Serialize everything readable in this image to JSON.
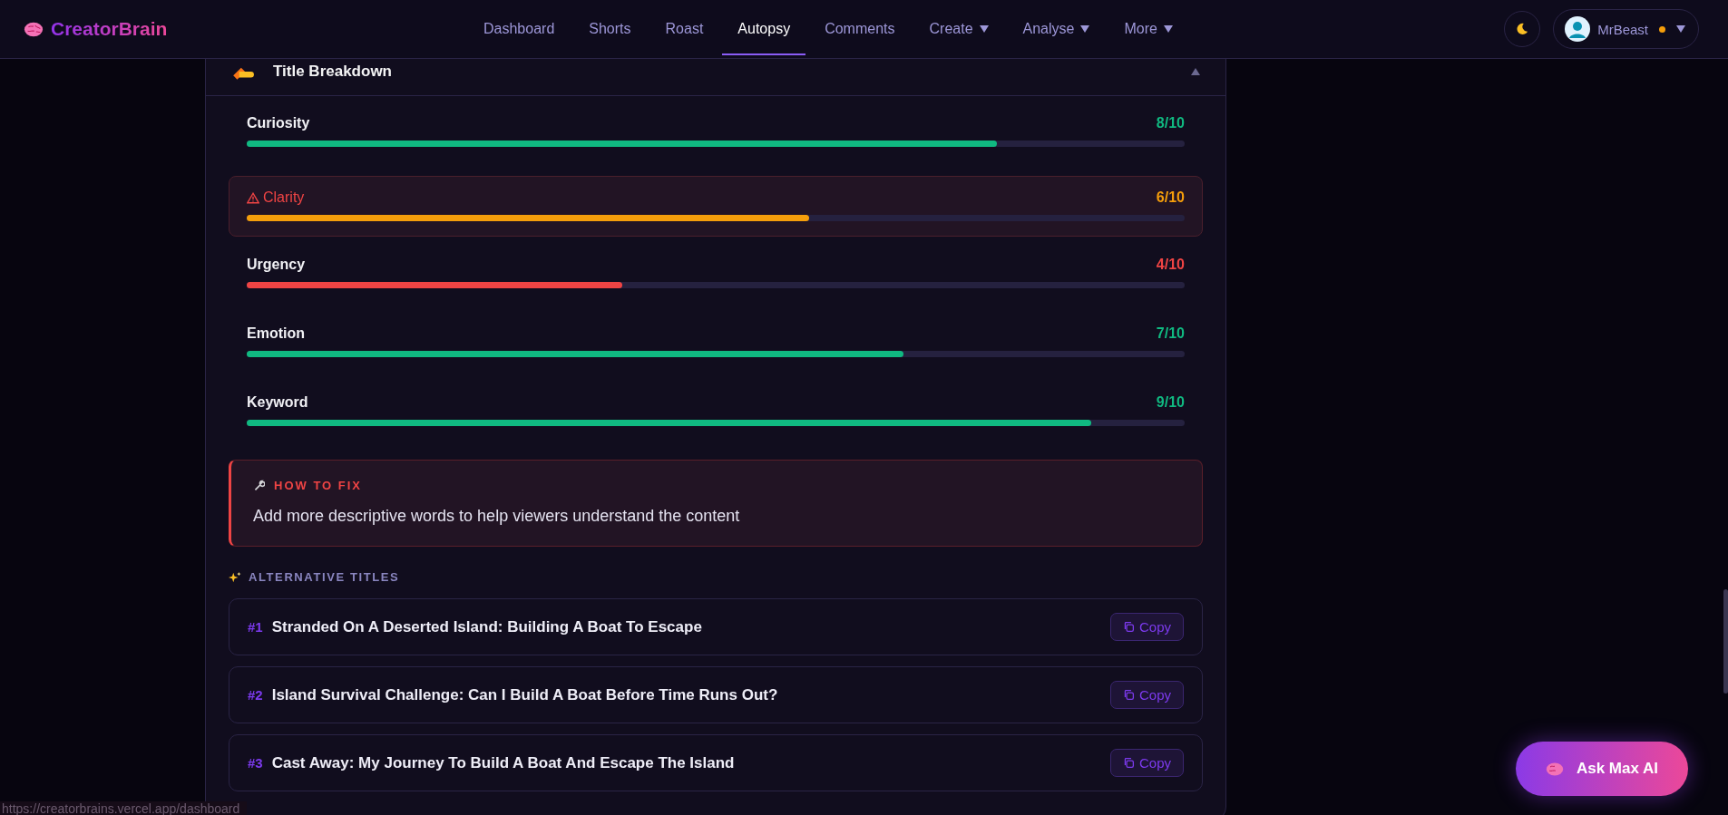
{
  "brand": {
    "name": "CreatorBrain"
  },
  "nav": [
    {
      "label": "Dashboard",
      "kind": "link",
      "selected": false
    },
    {
      "label": "Shorts",
      "kind": "link",
      "selected": false
    },
    {
      "label": "Roast",
      "kind": "link",
      "selected": false
    },
    {
      "label": "Autopsy",
      "kind": "link",
      "selected": true
    },
    {
      "label": "Comments",
      "kind": "link",
      "selected": false
    },
    {
      "label": "Create",
      "kind": "dropdown",
      "selected": false
    },
    {
      "label": "Analyse",
      "kind": "dropdown",
      "selected": false
    },
    {
      "label": "More",
      "kind": "dropdown",
      "selected": false
    }
  ],
  "user": {
    "name": "MrBeast",
    "online": true
  },
  "section": {
    "title": "Title Breakdown",
    "expanded": true
  },
  "metrics": [
    {
      "name": "Curiosity",
      "score": "8/10",
      "level": 0.8,
      "color": "#10b981",
      "warning": false
    },
    {
      "name": "Clarity",
      "score": "6/10",
      "level": 0.6,
      "color": "#f59e0b",
      "warning": true
    },
    {
      "name": "Urgency",
      "score": "4/10",
      "level": 0.4,
      "color": "#ef4444",
      "warning": false
    },
    {
      "name": "Emotion",
      "score": "7/10",
      "level": 0.7,
      "color": "#10b981",
      "warning": false
    },
    {
      "name": "Keyword",
      "score": "9/10",
      "level": 0.9,
      "color": "#10b981",
      "warning": false
    }
  ],
  "fix": {
    "heading": "HOW TO FIX",
    "text": "Add more descriptive words to help viewers understand the content"
  },
  "alternatives": {
    "heading": "ALTERNATIVE TITLES",
    "items": [
      {
        "rank": "#1",
        "title": "Stranded On A Deserted Island: Building A Boat To Escape",
        "action": "Copy"
      },
      {
        "rank": "#2",
        "title": "Island Survival Challenge: Can I Build A Boat Before Time Runs Out?",
        "action": "Copy"
      },
      {
        "rank": "#3",
        "title": "Cast Away: My Journey To Build A Boat And Escape The Island",
        "action": "Copy"
      }
    ]
  },
  "assistant": {
    "label": "Ask Max AI"
  },
  "status_url": "https://creatorbrains.vercel.app/dashboard"
}
